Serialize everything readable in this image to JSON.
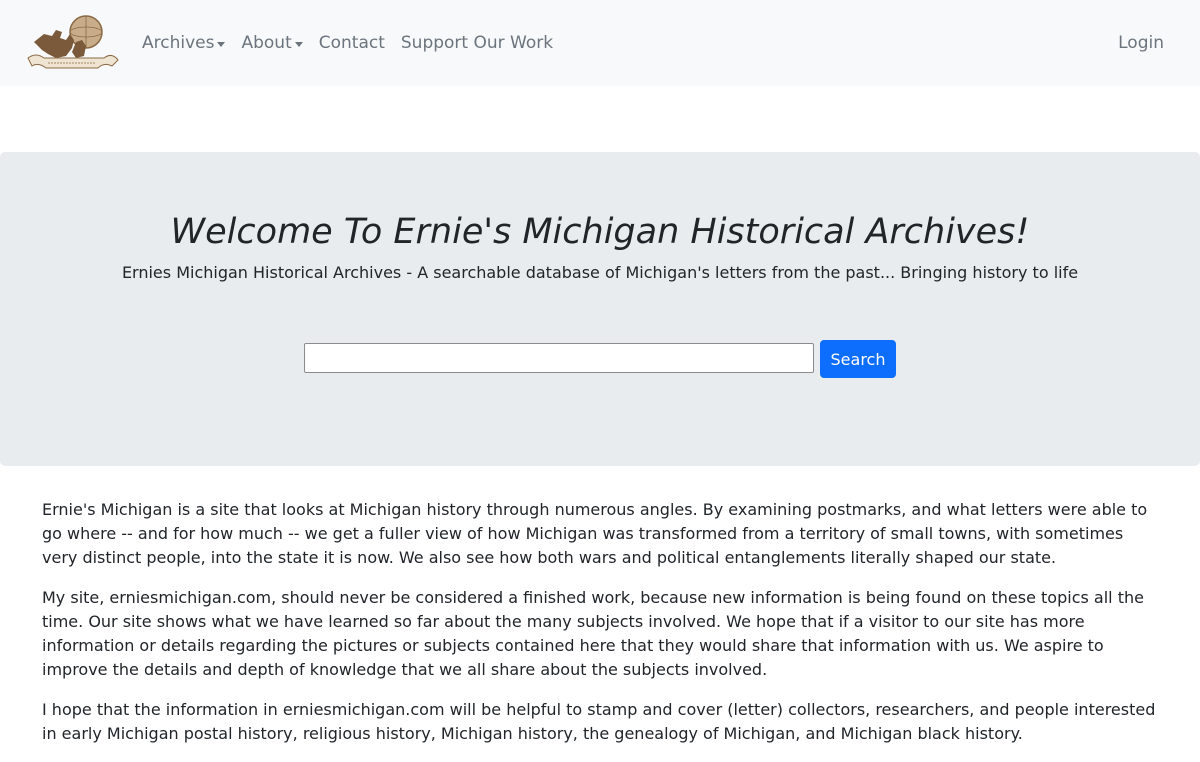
{
  "navbar": {
    "logo_icon": "michigan-logo-icon",
    "items": [
      {
        "label": "Archives",
        "dropdown": true
      },
      {
        "label": "About",
        "dropdown": true
      },
      {
        "label": "Contact",
        "dropdown": false
      },
      {
        "label": "Support Our Work",
        "dropdown": false
      }
    ],
    "login_label": "Login"
  },
  "hero": {
    "title": "Welcome To Ernie's Michigan Historical Archives!",
    "subtitle": "Ernies Michigan Historical Archives - A searchable database of Michigan's letters from the past... Bringing history to life",
    "search_value": "",
    "search_button_label": "Search",
    "accent_color": "#0d6efd"
  },
  "content": {
    "paragraphs": [
      "Ernie's Michigan is a site that looks at Michigan history through numerous angles. By examining postmarks, and what letters were able to go where -- and for how much -- we get a fuller view of how Michigan was transformed from a territory of small towns, with sometimes very distinct people, into the state it is now. We also see how both wars and political entanglements literally shaped our state.",
      "My site, erniesmichigan.com, should never be considered a finished work, because new information is being found on these topics all the time. Our site shows what we have learned so far about the many subjects involved. We hope that if a visitor to our site has more information or details regarding the pictures or subjects contained here that they would share that information with us. We aspire to improve the details and depth of knowledge that we all share about the subjects involved.",
      "I hope that the information in erniesmichigan.com will be helpful to stamp and cover (letter) collectors, researchers, and people interested in early Michigan postal history, religious history, Michigan history, the genealogy of Michigan, and Michigan black history."
    ]
  }
}
